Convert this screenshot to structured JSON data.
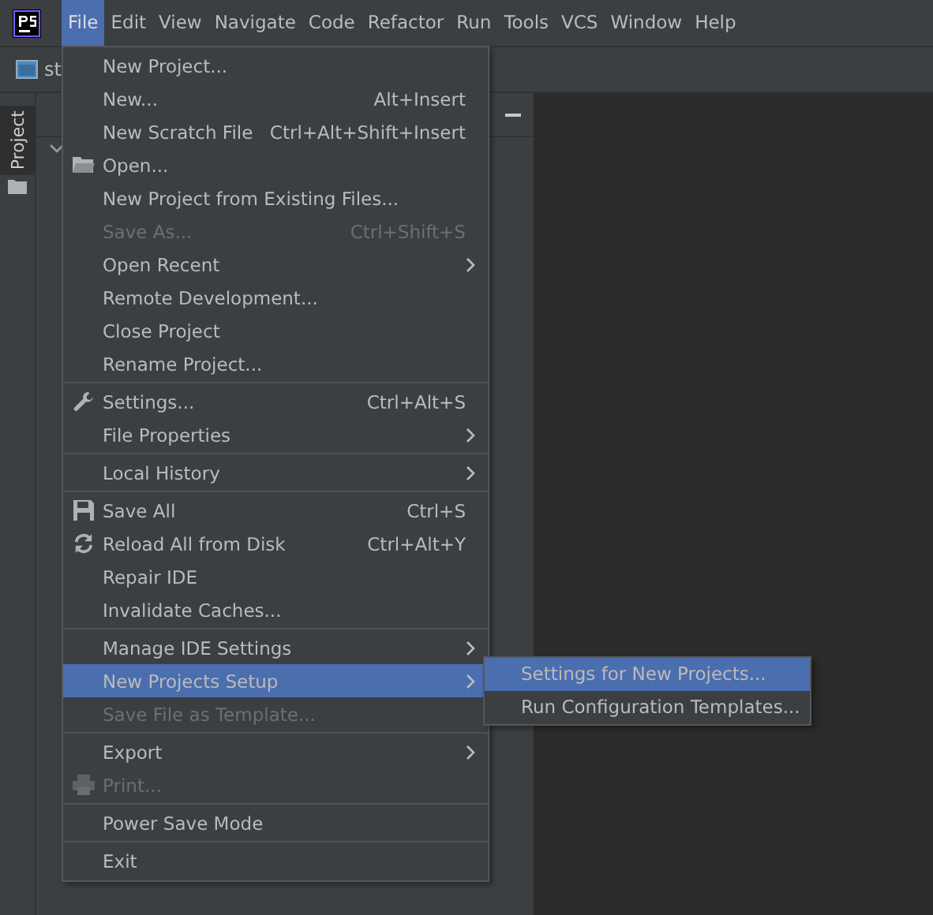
{
  "menu_bar": {
    "items": [
      {
        "label": "File",
        "selected": true
      },
      {
        "label": "Edit",
        "selected": false
      },
      {
        "label": "View",
        "selected": false
      },
      {
        "label": "Navigate",
        "selected": false
      },
      {
        "label": "Code",
        "selected": false
      },
      {
        "label": "Refactor",
        "selected": false
      },
      {
        "label": "Run",
        "selected": false
      },
      {
        "label": "Tools",
        "selected": false
      },
      {
        "label": "VCS",
        "selected": false
      },
      {
        "label": "Window",
        "selected": false
      },
      {
        "label": "Help",
        "selected": false
      }
    ]
  },
  "toolbar": {
    "breadcrumb": "st"
  },
  "side_tabs": [
    {
      "label": "Project",
      "selected": true
    }
  ],
  "file_menu": {
    "groups": [
      [
        {
          "label": "New Project...",
          "selected": false,
          "disabled": false
        },
        {
          "label": "New...",
          "shortcut": "Alt+Insert",
          "selected": false,
          "disabled": false
        },
        {
          "label": "New Scratch File",
          "shortcut": "Ctrl+Alt+Shift+Insert",
          "selected": false,
          "disabled": false
        },
        {
          "label": "Open...",
          "kind": "folder",
          "selected": false,
          "disabled": false
        },
        {
          "label": "New Project from Existing Files...",
          "selected": false,
          "disabled": false
        },
        {
          "label": "Save As...",
          "shortcut": "Ctrl+Shift+S",
          "selected": false,
          "disabled": true
        },
        {
          "label": "Open Recent",
          "submenu": true,
          "selected": false,
          "disabled": false
        },
        {
          "label": "Remote Development...",
          "selected": false,
          "disabled": false
        },
        {
          "label": "Close Project",
          "selected": false,
          "disabled": false
        },
        {
          "label": "Rename Project...",
          "selected": false,
          "disabled": false
        }
      ],
      [
        {
          "label": "Settings...",
          "shortcut": "Ctrl+Alt+S",
          "kind": "wrench",
          "selected": false,
          "disabled": false
        },
        {
          "label": "File Properties",
          "submenu": true,
          "selected": false,
          "disabled": false
        }
      ],
      [
        {
          "label": "Local History",
          "submenu": true,
          "selected": false,
          "disabled": false
        }
      ],
      [
        {
          "label": "Save All",
          "shortcut": "Ctrl+S",
          "kind": "floppy",
          "selected": false,
          "disabled": false
        },
        {
          "label": "Reload All from Disk",
          "shortcut": "Ctrl+Alt+Y",
          "kind": "reload",
          "selected": false,
          "disabled": false
        },
        {
          "label": "Repair IDE",
          "selected": false,
          "disabled": false
        },
        {
          "label": "Invalidate Caches...",
          "selected": false,
          "disabled": false
        }
      ],
      [
        {
          "label": "Manage IDE Settings",
          "submenu": true,
          "selected": false,
          "disabled": false
        },
        {
          "label": "New Projects Setup",
          "submenu": true,
          "selected": true,
          "disabled": false
        },
        {
          "label": "Save File as Template...",
          "selected": false,
          "disabled": true
        }
      ],
      [
        {
          "label": "Export",
          "submenu": true,
          "selected": false,
          "disabled": false
        },
        {
          "label": "Print...",
          "kind": "printer",
          "selected": false,
          "disabled": true
        }
      ],
      [
        {
          "label": "Power Save Mode",
          "selected": false,
          "disabled": false
        }
      ],
      [
        {
          "label": "Exit",
          "selected": false,
          "disabled": false
        }
      ]
    ]
  },
  "submenu": {
    "items": [
      {
        "label": "Settings for New Projects...",
        "selected": true
      },
      {
        "label": "Run Configuration Templates...",
        "selected": false
      }
    ]
  }
}
